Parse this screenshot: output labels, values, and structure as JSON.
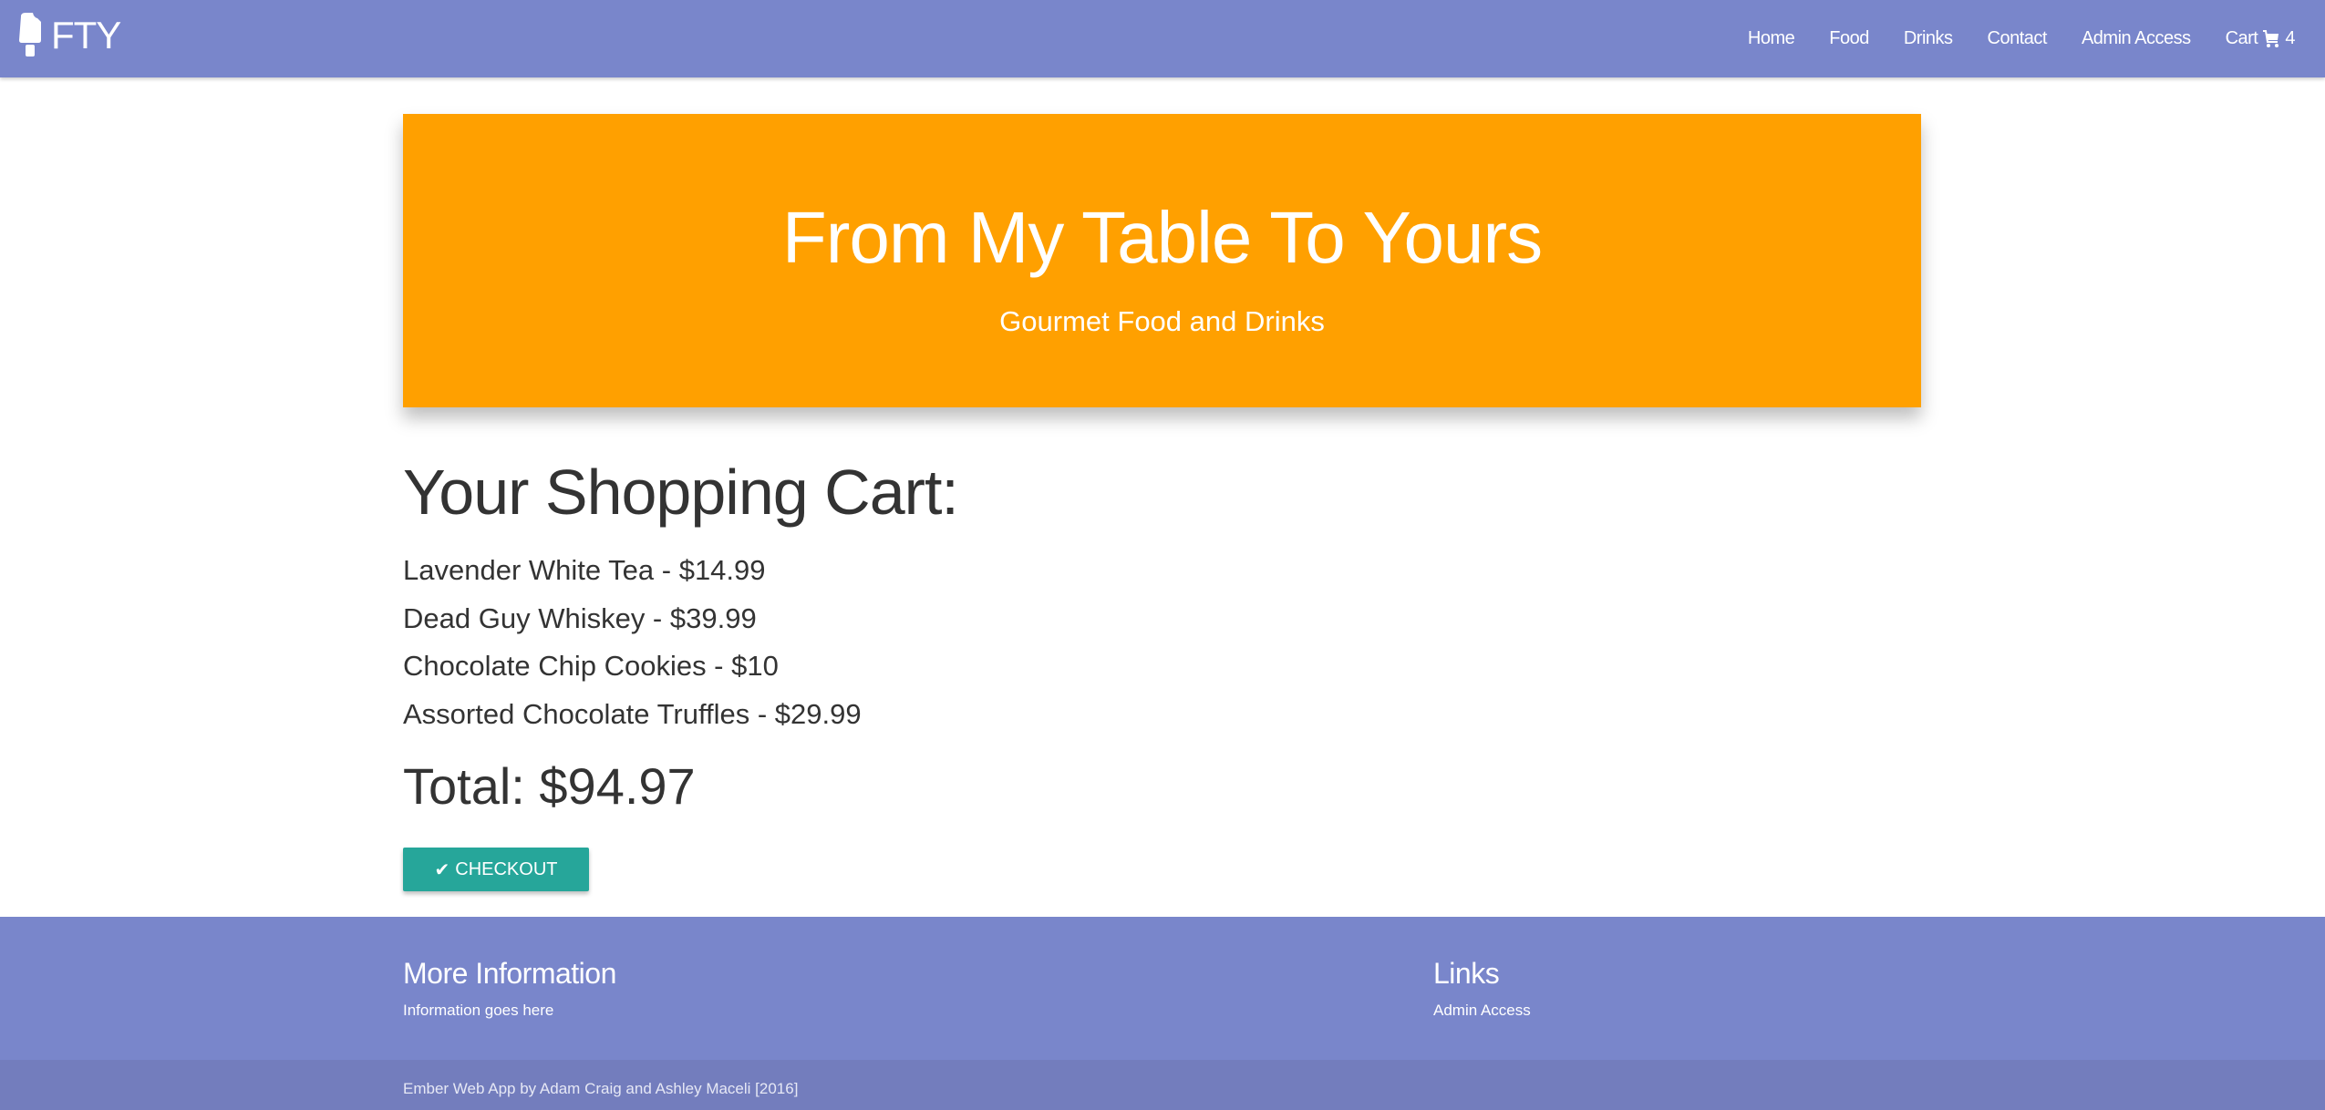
{
  "nav": {
    "brand": "FTY",
    "items": [
      "Home",
      "Food",
      "Drinks",
      "Contact",
      "Admin Access"
    ],
    "cart_label": "Cart",
    "cart_count": "4"
  },
  "banner": {
    "title": "From My Table To Yours",
    "subtitle": "Gourmet Food and Drinks"
  },
  "cart": {
    "heading": "Your Shopping Cart:",
    "items": [
      "Lavender White Tea - $14.99",
      "Dead Guy Whiskey - $39.99",
      "Chocolate Chip Cookies - $10",
      "Assorted Chocolate Truffles - $29.99"
    ],
    "total": "Total: $94.97",
    "checkout_label": "CHECKOUT"
  },
  "footer": {
    "info_title": "More Information",
    "info_text": "Information goes here",
    "links_title": "Links",
    "links": [
      "Admin Access"
    ],
    "copyright": "Ember Web App by Adam Craig and Ashley Maceli [2016]"
  },
  "colors": {
    "nav": "#7986cb",
    "banner": "#ffa000",
    "checkout": "#26a69a"
  }
}
